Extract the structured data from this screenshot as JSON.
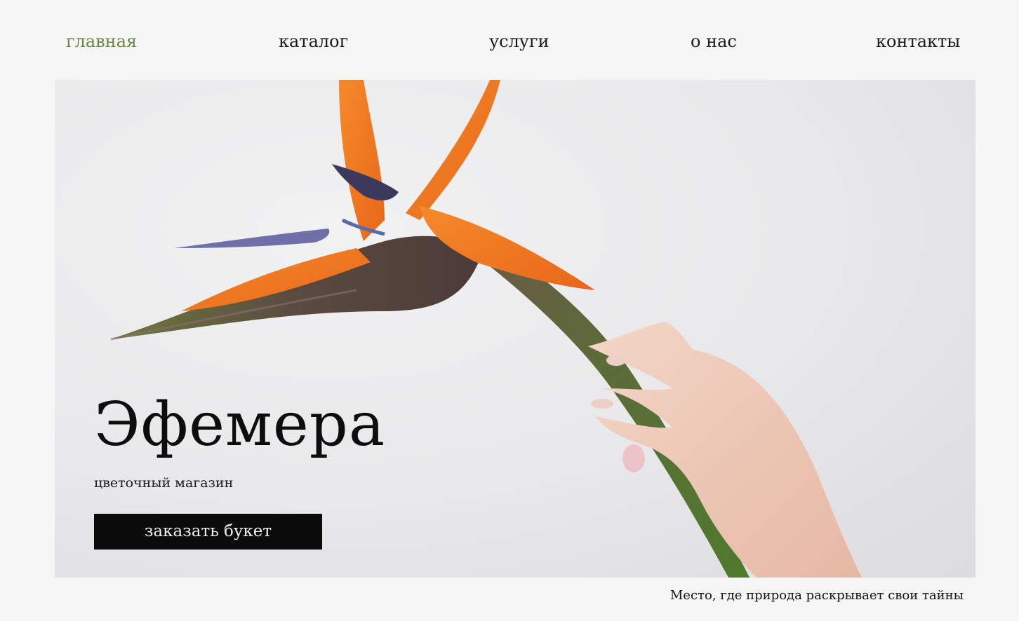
{
  "nav": {
    "items": [
      {
        "label": "главная",
        "active": true
      },
      {
        "label": "каталог",
        "active": false
      },
      {
        "label": "услуги",
        "active": false
      },
      {
        "label": "о нас",
        "active": false
      },
      {
        "label": "контакты",
        "active": false
      }
    ]
  },
  "hero": {
    "title": "Эфемера",
    "subtitle": "цветочный магазин",
    "cta_label": "заказать букет",
    "image_subject": "bird-of-paradise flower held by hand"
  },
  "footer": {
    "tagline": "Место, где природа раскрывает свои тайны"
  },
  "colors": {
    "background": "#f6f6f6",
    "active_nav": "#6a8640",
    "text": "#111111",
    "button_bg": "#0b0b0b",
    "button_text": "#f2f2f2"
  }
}
